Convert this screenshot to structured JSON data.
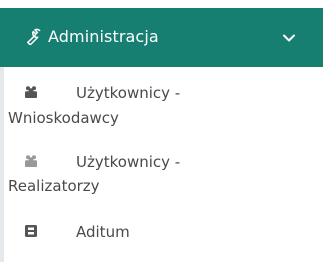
{
  "menu": {
    "header_label": "Administracja",
    "header_icon": "wrench-icon",
    "toggle_icon": "chevron-down-icon",
    "accent_color": "#177f72",
    "items": [
      {
        "line1": "Użytkownicy -",
        "line2": "Wnioskodawcy",
        "icon": "users-icon"
      },
      {
        "line1": "Użytkownicy -",
        "line2": "Realizatorzy",
        "icon": "users-icon"
      },
      {
        "line1": "Aditum",
        "icon": "id-card-icon"
      }
    ]
  }
}
